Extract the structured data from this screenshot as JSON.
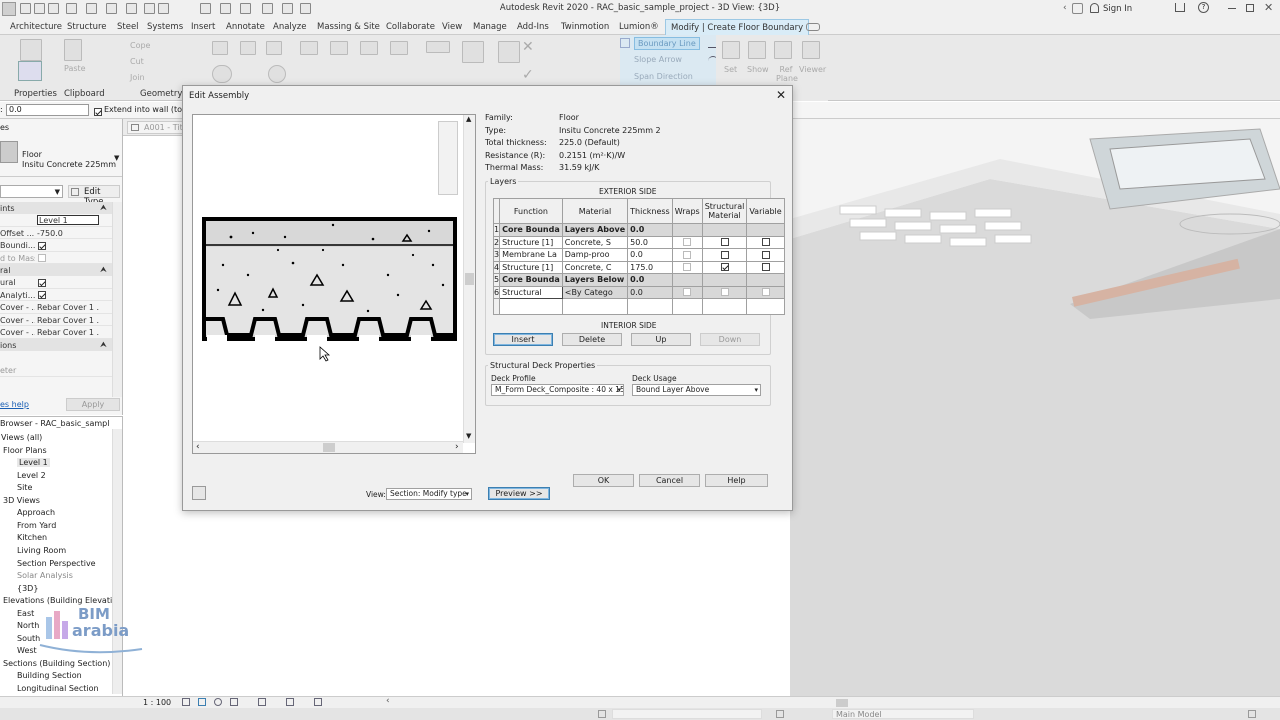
{
  "app": {
    "title": "Autodesk Revit 2020 - RAC_basic_sample_project - 3D View: {3D}",
    "sign_in": "Sign In"
  },
  "ribbon": {
    "tabs": [
      "Architecture",
      "Structure",
      "Steel",
      "Systems",
      "Insert",
      "Annotate",
      "Analyze",
      "Massing & Site",
      "Collaborate",
      "View",
      "Manage",
      "Add-Ins",
      "Twinmotion",
      "Lumion®",
      "Modify | Create Floor Boundary"
    ],
    "panels": {
      "properties": "Properties",
      "clipboard": "Clipboard",
      "geometry": "Geometry"
    },
    "buttons": {
      "paste": "Paste",
      "cope": "Cope",
      "cut": "Cut",
      "join": "Join",
      "boundary_line": "Boundary Line",
      "slope_arrow": "Slope Arrow",
      "span_direction": "Span Direction",
      "set": "Set",
      "show": "Show",
      "ref_plane": "Ref Plane",
      "viewer": "Viewer"
    }
  },
  "options_bar": {
    "offset_value": "0.0",
    "extend_label": "Extend into wall (to c"
  },
  "doc_tab": {
    "label": "A001 - Tit"
  },
  "properties": {
    "type_name": "Floor",
    "type_sub": "Insitu Concrete 225mm",
    "edit_type": "Edit Type",
    "section_constraints": "ints",
    "rows": [
      {
        "k": "",
        "v": "Level 1"
      },
      {
        "k": "Offset ...",
        "v": "-750.0"
      },
      {
        "k": "Boundi...",
        "v": ""
      },
      {
        "k": "d to Mass",
        "v": ""
      }
    ],
    "section_structural": "ral",
    "rows2": [
      {
        "k": "ural",
        "v": ""
      },
      {
        "k": "Analyti...",
        "v": ""
      },
      {
        "k": "Cover - ...",
        "v": "Rebar Cover 1 ..."
      },
      {
        "k": "Cover - ...",
        "v": "Rebar Cover 1 ..."
      },
      {
        "k": "Cover - ...",
        "v": "Rebar Cover 1 ..."
      }
    ],
    "section_dimensions": "ions",
    "rows3": [
      {
        "k": "eter",
        "v": ""
      }
    ],
    "help": "es help",
    "apply": "Apply"
  },
  "browser": {
    "title": "Browser - RAC_basic_sample_p...",
    "items": [
      {
        "t": "Views (all)",
        "x": 1,
        "g": false
      },
      {
        "t": "Floor Plans",
        "x": 3,
        "g": false
      },
      {
        "t": "Level 1",
        "x": 17,
        "g": false
      },
      {
        "t": "Level 2",
        "x": 17,
        "g": false
      },
      {
        "t": "Site",
        "x": 17,
        "g": false
      },
      {
        "t": "3D Views",
        "x": 3,
        "g": false
      },
      {
        "t": "Approach",
        "x": 17,
        "g": false
      },
      {
        "t": "From Yard",
        "x": 17,
        "g": false
      },
      {
        "t": "Kitchen",
        "x": 17,
        "g": false
      },
      {
        "t": "Living Room",
        "x": 17,
        "g": false
      },
      {
        "t": "Section Perspective",
        "x": 17,
        "g": false
      },
      {
        "t": "Solar Analysis",
        "x": 17,
        "g": true
      },
      {
        "t": "{3D}",
        "x": 17,
        "g": false
      },
      {
        "t": "Elevations (Building Elevation",
        "x": 3,
        "g": false
      },
      {
        "t": "East",
        "x": 17,
        "g": false
      },
      {
        "t": "North",
        "x": 17,
        "g": false
      },
      {
        "t": "South",
        "x": 17,
        "g": false
      },
      {
        "t": "West",
        "x": 17,
        "g": false
      },
      {
        "t": "Sections (Building Section)",
        "x": 3,
        "g": false
      },
      {
        "t": "Building Section",
        "x": 17,
        "g": false
      },
      {
        "t": "Longitudinal Section",
        "x": 17,
        "g": false
      }
    ]
  },
  "status": {
    "scale": "1 : 100",
    "model": "Main Model"
  },
  "logo": {
    "line1": "BIM",
    "line2": "arabia"
  },
  "dialog": {
    "title": "Edit Assembly",
    "info": [
      {
        "k": "Family:",
        "v": "Floor"
      },
      {
        "k": "Type:",
        "v": "Insitu Concrete 225mm 2"
      },
      {
        "k": "Total thickness:",
        "v": "225.0 (Default)"
      },
      {
        "k": "Resistance (R):",
        "v": "0.2151 (m²·K)/W"
      },
      {
        "k": "Thermal Mass:",
        "v": "31.59 kJ/K"
      }
    ],
    "layers_label": "Layers",
    "exterior": "EXTERIOR SIDE",
    "interior": "INTERIOR SIDE",
    "columns": [
      "Function",
      "Material",
      "Thickness",
      "Wraps",
      "Structural Material",
      "Variable"
    ],
    "rows": [
      {
        "i": "1",
        "f": "Core Bounda",
        "m": "Layers Above",
        "t": "0.0",
        "core": true,
        "w": null,
        "s": null,
        "var": null
      },
      {
        "i": "2",
        "f": "Structure [1]",
        "m": "Concrete, S",
        "t": "50.0",
        "core": false,
        "w": "dim",
        "s": "off",
        "var": "off"
      },
      {
        "i": "3",
        "f": "Membrane La",
        "m": "Damp-proo",
        "t": "0.0",
        "core": false,
        "w": "dim",
        "s": "off",
        "var": "off"
      },
      {
        "i": "4",
        "f": "Structure [1]",
        "m": "Concrete, C",
        "t": "175.0",
        "core": false,
        "w": "dim",
        "s": "on",
        "var": "off"
      },
      {
        "i": "5",
        "f": "Core Bounda",
        "m": "Layers Below",
        "t": "0.0",
        "core": true,
        "w": null,
        "s": null,
        "var": null
      },
      {
        "i": "6",
        "f": "Structural",
        "m": "<By Catego",
        "t": "0.0",
        "core": false,
        "gray": true,
        "w": "dim",
        "s": "dim",
        "var": "dim"
      }
    ],
    "buttons": {
      "insert": "Insert",
      "delete": "Delete",
      "up": "Up",
      "down": "Down"
    },
    "deck": {
      "group": "Structural Deck Properties",
      "profile_label": "Deck Profile",
      "profile_value": "M_Form Deck_Composite : 40 x 15",
      "usage_label": "Deck Usage",
      "usage_value": "Bound Layer Above"
    },
    "view_label": "View:",
    "view_value": "Section: Modify type",
    "preview_btn": "Preview >>",
    "ok": "OK",
    "cancel": "Cancel",
    "help": "Help"
  }
}
